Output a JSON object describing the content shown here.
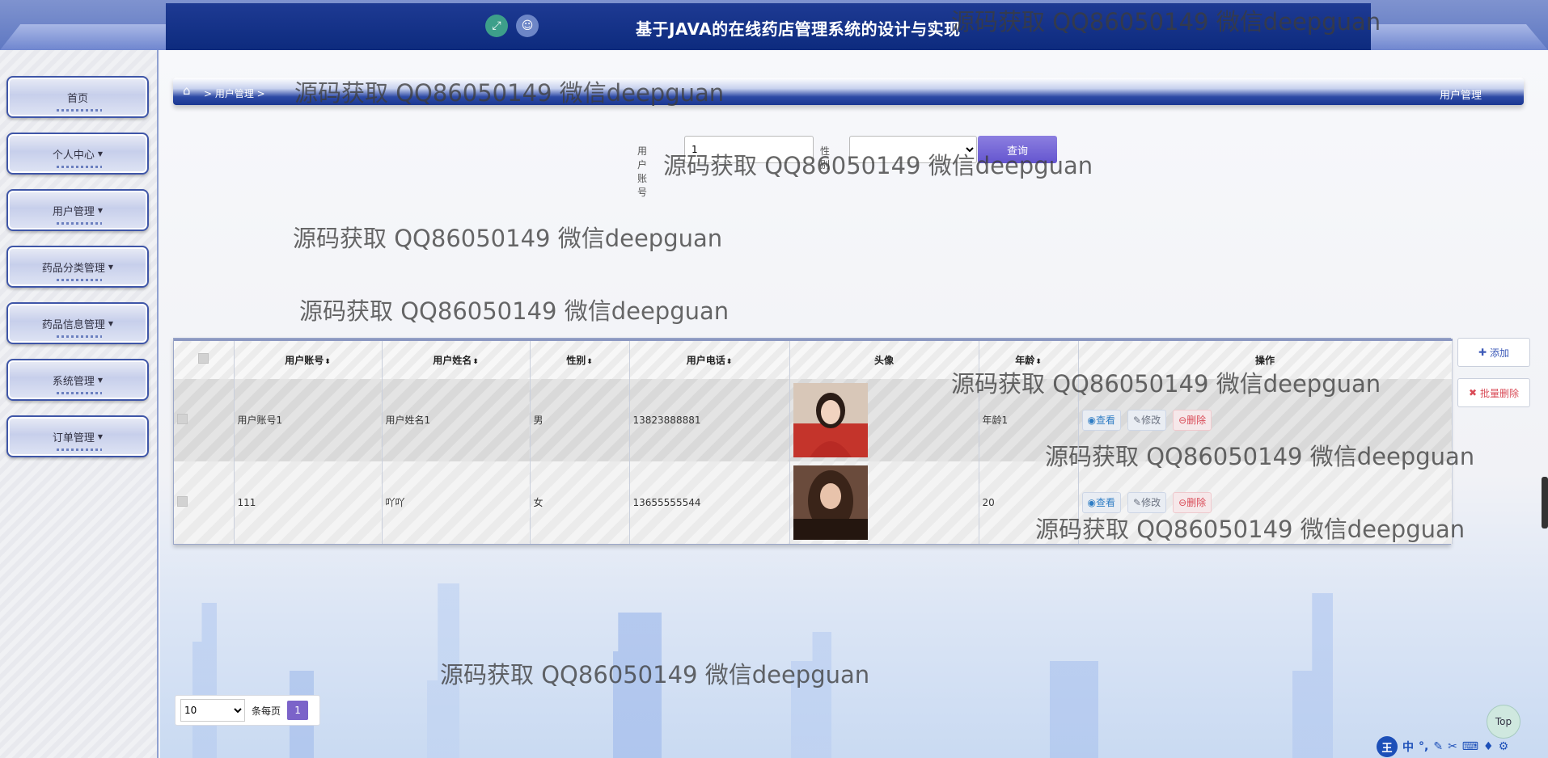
{
  "header": {
    "title": "基于JAVA的在线药店管理系统的设计与实现",
    "expand_icon": "expand-icon",
    "user_icon": "user-icon"
  },
  "sidebar": {
    "items": [
      {
        "label": "首页",
        "has_caret": false
      },
      {
        "label": "个人中心",
        "has_caret": true
      },
      {
        "label": "用户管理",
        "has_caret": true
      },
      {
        "label": "药品分类管理",
        "has_caret": true
      },
      {
        "label": "药品信息管理",
        "has_caret": true
      },
      {
        "label": "系统管理",
        "has_caret": true
      },
      {
        "label": "订单管理",
        "has_caret": true
      }
    ]
  },
  "breadcrumb": {
    "path": "> 用户管理 >",
    "right_title": "用户管理"
  },
  "search": {
    "account_label": "用户账号",
    "account_value": "1",
    "gender_label": "性别",
    "gender_value": "",
    "query_label": "查询"
  },
  "table": {
    "columns": [
      "用户账号",
      "用户姓名",
      "性别",
      "用户电话",
      "头像",
      "年龄",
      "操作"
    ],
    "sortable": [
      "用户账号",
      "用户姓名",
      "性别",
      "用户电话",
      "年龄"
    ],
    "rows": [
      {
        "account": "用户账号1",
        "name": "用户姓名1",
        "gender": "男",
        "phone": "13823888881",
        "age": "年龄1"
      },
      {
        "account": "111",
        "name": "吖吖",
        "gender": "女",
        "phone": "13655555544",
        "age": "20"
      }
    ],
    "actions": {
      "view": "查看",
      "edit": "修改",
      "delete": "删除"
    }
  },
  "side_actions": {
    "add": "添加",
    "batch_delete": "批量删除"
  },
  "pagination": {
    "page_size": "10",
    "per_page_label": "条每页",
    "current_page": "1"
  },
  "top_button": "Top",
  "watermark": "源码获取 QQ86050149 微信deepguan",
  "ime": {
    "logo": "王",
    "mode": "中"
  },
  "colors": {
    "header": "#0d2b7e",
    "accent": "#6455cf",
    "delete": "#d94b57",
    "view": "#2f7dc4"
  }
}
